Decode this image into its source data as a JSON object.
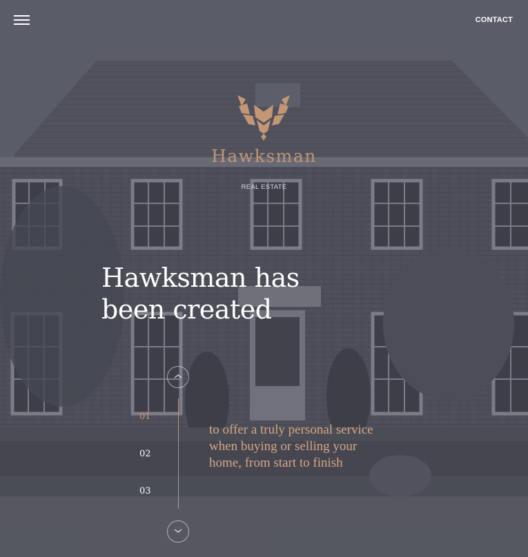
{
  "header": {
    "menu_icon": "hamburger-icon",
    "contact_label": "CONTACT"
  },
  "brand": {
    "logo_icon": "hawk-emblem-icon",
    "name": "Hawksman",
    "tagline": "REAL ESTATE",
    "accent_color": "#c39675"
  },
  "hero": {
    "headline_line1": "Hawksman has",
    "headline_line2": "been created",
    "description": "to offer a truly personal service when buying or selling your home, from start to finish"
  },
  "slider": {
    "up_icon": "chevron-up-icon",
    "down_icon": "chevron-down-icon",
    "steps": [
      {
        "label": "01",
        "active": true
      },
      {
        "label": "02",
        "active": false
      },
      {
        "label": "03",
        "active": false
      }
    ]
  }
}
